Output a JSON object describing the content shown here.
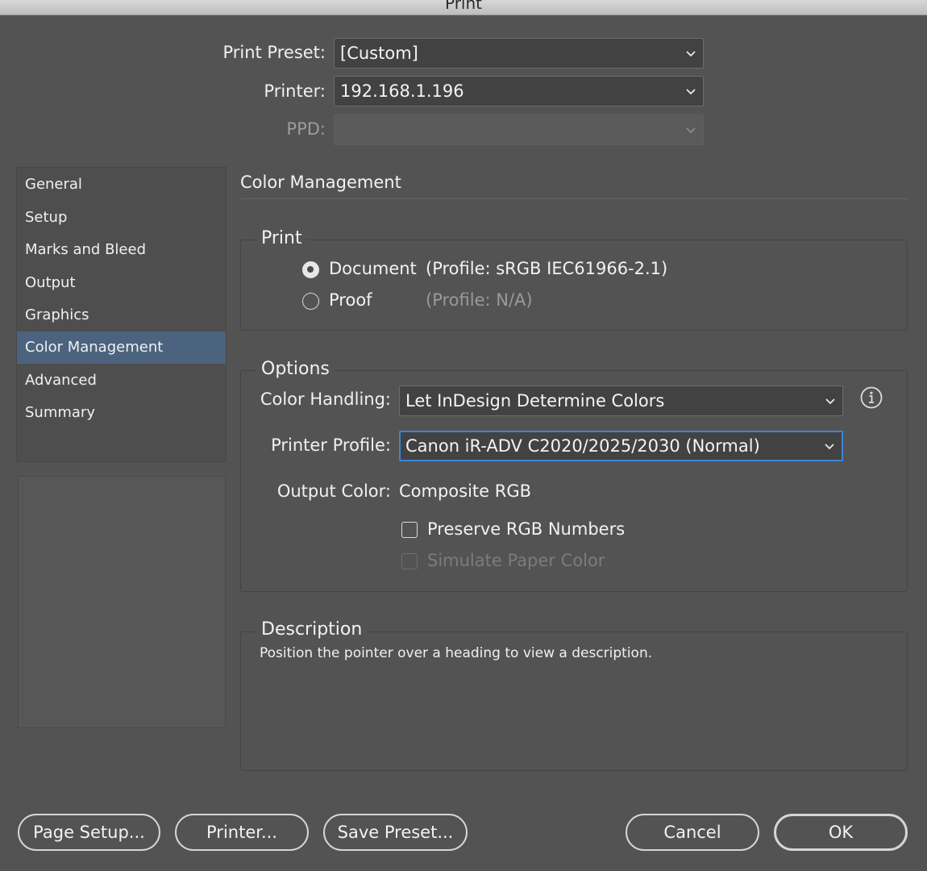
{
  "window": {
    "title": "Print"
  },
  "header": {
    "print_preset_label": "Print Preset:",
    "print_preset_value": "[Custom]",
    "printer_label": "Printer:",
    "printer_value": "192.168.1.196",
    "ppd_label": "PPD:",
    "ppd_value": ""
  },
  "sidebar": {
    "items": [
      {
        "label": "General"
      },
      {
        "label": "Setup"
      },
      {
        "label": "Marks and Bleed"
      },
      {
        "label": "Output"
      },
      {
        "label": "Graphics"
      },
      {
        "label": "Color Management",
        "selected": true
      },
      {
        "label": "Advanced"
      },
      {
        "label": "Summary"
      }
    ]
  },
  "main": {
    "section_title": "Color Management",
    "print_group": {
      "legend": "Print",
      "document_label": "Document",
      "document_profile": "(Profile: sRGB IEC61966-2.1)",
      "proof_label": "Proof",
      "proof_profile": "(Profile: N/A)",
      "selected": "Document"
    },
    "options_group": {
      "legend": "Options",
      "color_handling_label": "Color Handling:",
      "color_handling_value": "Let InDesign Determine Colors",
      "printer_profile_label": "Printer Profile:",
      "printer_profile_value": "Canon iR-ADV C2020/2025/2030 (Normal)",
      "output_color_label": "Output Color:",
      "output_color_value": "Composite RGB",
      "preserve_rgb_label": "Preserve RGB Numbers",
      "preserve_rgb_checked": false,
      "simulate_paper_label": "Simulate Paper Color",
      "simulate_paper_checked": false,
      "simulate_paper_enabled": false
    },
    "description_group": {
      "legend": "Description",
      "text": "Position the pointer over a heading to view a description."
    }
  },
  "footer": {
    "page_setup_label": "Page Setup...",
    "printer_label": "Printer...",
    "save_preset_label": "Save Preset...",
    "cancel_label": "Cancel",
    "ok_label": "OK"
  },
  "colors": {
    "background": "#535353",
    "selection": "#4b637f",
    "focus_ring": "#3a86d8"
  }
}
